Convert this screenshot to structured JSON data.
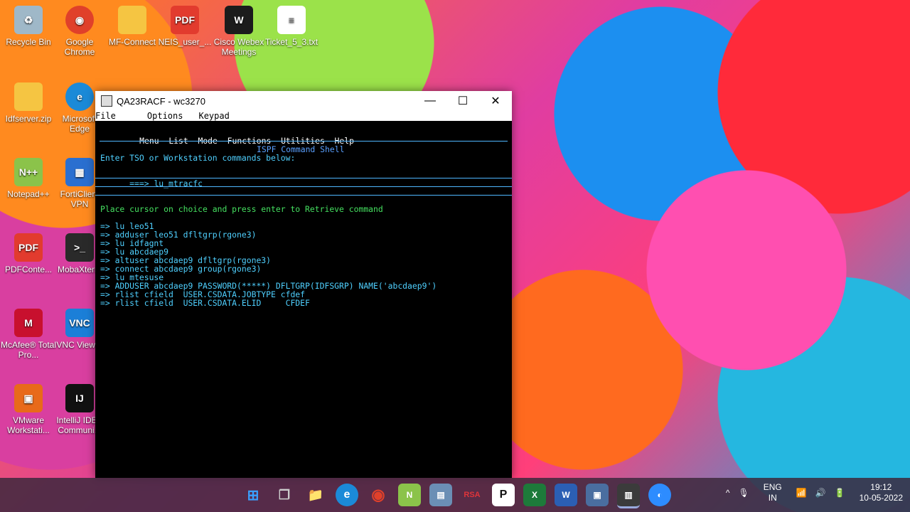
{
  "desktop": {
    "icons": [
      {
        "label": "Recycle Bin",
        "icon": "recycle-bin-icon",
        "color": "#9fb8c8"
      },
      {
        "label": "Google Chrome",
        "icon": "chrome-icon",
        "color": "#e0402a"
      },
      {
        "label": "MF-Connect",
        "icon": "folder-icon",
        "color": "#f5c542"
      },
      {
        "label": "NEIS_user_...",
        "icon": "pdf-icon",
        "color": "#e23b2e"
      },
      {
        "label": "Cisco Webex Meetings",
        "icon": "webex-icon",
        "color": "#1c1c1c"
      },
      {
        "label": "Ticket_5_3.txt",
        "icon": "text-file-icon",
        "color": "#ffffff"
      },
      {
        "label": "Idfserver.zip",
        "icon": "zip-folder-icon",
        "color": "#f5c542"
      },
      {
        "label": "Microsoft Edge",
        "icon": "edge-icon",
        "color": "#1b8ad8"
      },
      {
        "label": "Notepad++",
        "icon": "notepad-plus-plus-icon",
        "color": "#8bc34a"
      },
      {
        "label": "FortiClient VPN",
        "icon": "forticlient-icon",
        "color": "#2a6fd0"
      },
      {
        "label": "PDFConte...",
        "icon": "pdf-icon",
        "color": "#e23b2e"
      },
      {
        "label": "MobaXterm",
        "icon": "mobaxterm-icon",
        "color": "#2a2a2a"
      },
      {
        "label": "McAfee® Total Pro...",
        "icon": "mcafee-icon",
        "color": "#c8102e"
      },
      {
        "label": "VNC Viewer",
        "icon": "vnc-icon",
        "color": "#1b7fd8"
      },
      {
        "label": "VMware Workstati...",
        "icon": "vmware-icon",
        "color": "#e86a1a"
      },
      {
        "label": "IntelliJ IDEA Communi...",
        "icon": "intellij-icon",
        "color": "#111111"
      }
    ]
  },
  "window": {
    "title": "QA23RACF - wc3270",
    "minimize": "—",
    "maximize": "☐",
    "close": "✕",
    "menu": [
      "File",
      "Options",
      "Keypad"
    ]
  },
  "terminal": {
    "action_bar": [
      "Menu",
      "List",
      "Mode",
      "Functions",
      "Utilities",
      "Help"
    ],
    "shell_title": "ISPF Command Shell",
    "prompt_text": "Enter TSO or Workstation commands below:",
    "command_prefix": "===>",
    "command_value": "lu_mtracfc",
    "instruction": "Place cursor on choice and press enter to Retrieve command",
    "history": [
      "=> lu leo51",
      "=> adduser leo51 dfltgrp(rgone3)",
      "=> lu idfagnt",
      "=> lu abcdaep9",
      "=> altuser abcdaep9 dfltgrp(rgone3)",
      "=> connect abcdaep9 group(rgone3)",
      "=> lu mtesuse",
      "=> ADDUSER abcdaep9 PASSWORD(*****) DFLTGRP(IDFSGRP) NAME('abcdaep9')",
      "=> rlist cfield  USER.CSDATA.JOBTYPE cfdef",
      "=> rlist cfield  USER.CSDATA.ELID     CFDEF"
    ]
  },
  "taskbar": {
    "apps": [
      {
        "name": "start",
        "label": "⊞",
        "color": "#3aa0ff"
      },
      {
        "name": "task-view",
        "label": "❐",
        "color": "#888888"
      },
      {
        "name": "file-explorer",
        "label": "📁",
        "color": "#f5c542"
      },
      {
        "name": "edge",
        "label": "e",
        "color": "#1b8ad8"
      },
      {
        "name": "chrome",
        "label": "◉",
        "color": "#e0402a"
      },
      {
        "name": "notepad-plus-plus",
        "label": "N",
        "color": "#8bc34a"
      },
      {
        "name": "document",
        "label": "▤",
        "color": "#6b8fb5"
      },
      {
        "name": "rsa",
        "label": "RSA",
        "color": "#c8102e"
      },
      {
        "name": "pass",
        "label": "P",
        "color": "#111111"
      },
      {
        "name": "excel",
        "label": "X",
        "color": "#1d7a3a"
      },
      {
        "name": "word",
        "label": "W",
        "color": "#2b5fb4"
      },
      {
        "name": "monitor",
        "label": "▣",
        "color": "#4a6ea0"
      },
      {
        "name": "wc3270",
        "label": "▥",
        "color": "#3b3b3b"
      },
      {
        "name": "zoom",
        "label": "◐",
        "color": "#2d8cff"
      }
    ],
    "tray": {
      "chevron": "^",
      "mic": "🎙",
      "lang_top": "ENG",
      "lang_bottom": "IN",
      "wifi": "📶",
      "volume": "🔊",
      "battery": "🔋",
      "time": "19:12",
      "date": "10-05-2022"
    }
  }
}
